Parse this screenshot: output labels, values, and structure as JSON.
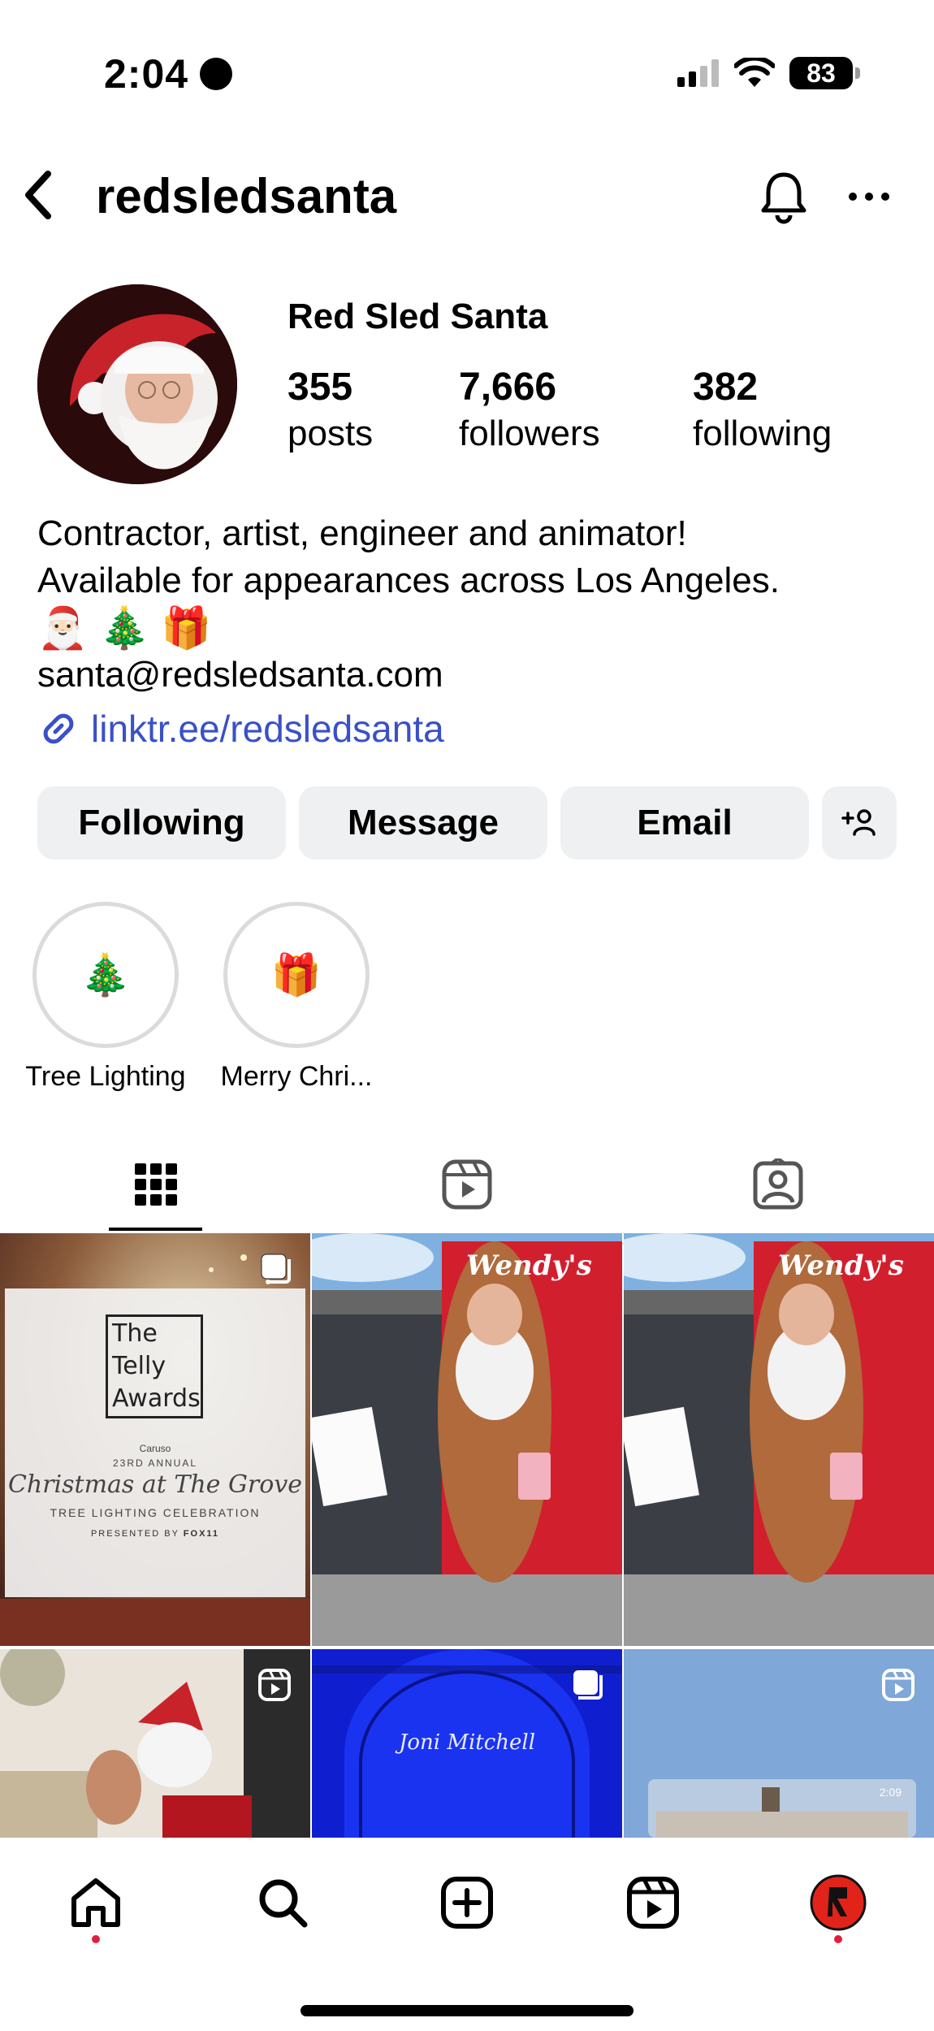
{
  "status": {
    "time": "2:04",
    "battery": "83"
  },
  "header": {
    "username": "redsledsanta"
  },
  "profile": {
    "display_name": "Red Sled Santa",
    "stats": [
      {
        "value": "355",
        "label": "posts"
      },
      {
        "value": "7,666",
        "label": "followers"
      },
      {
        "value": "382",
        "label": "following"
      }
    ],
    "bio_lines": [
      "Contractor, artist, engineer and animator!",
      "Available for appearances across Los Angeles."
    ],
    "bio_emoji": "🎅🏻 🎄 🎁",
    "email": "santa@redsledsanta.com",
    "link": "linktr.ee/redsledsanta"
  },
  "actions": {
    "following": "Following",
    "message": "Message",
    "email": "Email"
  },
  "highlights": [
    {
      "label": "Tree Lighting",
      "emoji": "🎄"
    },
    {
      "label": "Merry Chri...",
      "emoji": "🎁"
    }
  ],
  "posts": {
    "telly": {
      "line1": "The",
      "line2": "Telly",
      "line3": "Awards",
      "small": "Caruso",
      "annual": "23RD ANNUAL",
      "title": "Christmas at The Grove",
      "subtitle": "TREE LIGHTING CELEBRATION",
      "presented": "PRESENTED BY",
      "sponsor": "FOX11"
    },
    "wendys_sign": "Wendy's",
    "reel_time": "2:09",
    "signature": "Joni Mitchell"
  },
  "colors": {
    "link": "#3a50c8",
    "notification": "#e0203a",
    "wendys_red": "#d21f2e"
  }
}
